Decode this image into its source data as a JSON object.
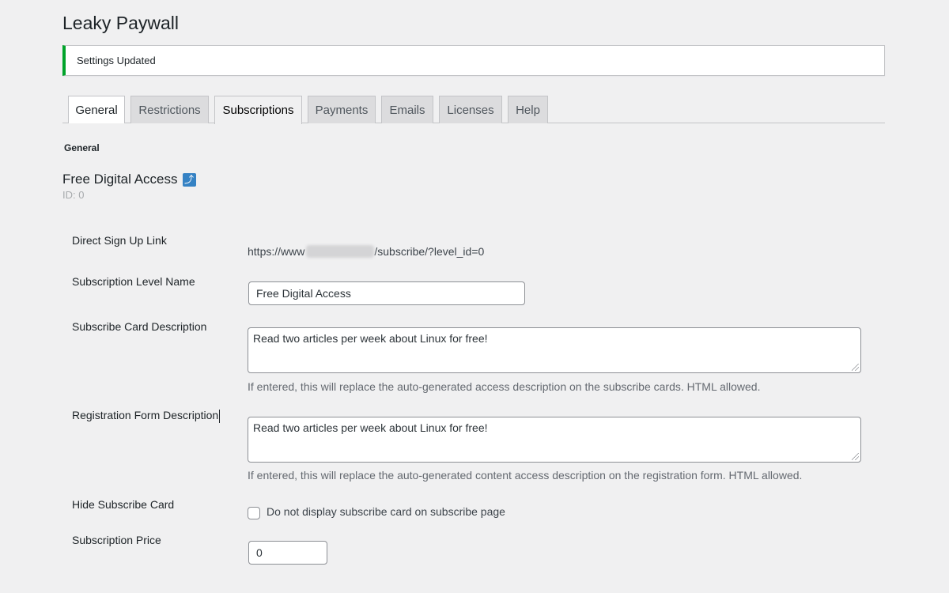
{
  "page": {
    "title": "Leaky Paywall"
  },
  "notice": {
    "text": "Settings Updated",
    "accent_color": "#00a32a"
  },
  "tabs": [
    {
      "label": "General"
    },
    {
      "label": "Restrictions"
    },
    {
      "label": "Subscriptions",
      "active": true
    },
    {
      "label": "Payments"
    },
    {
      "label": "Emails"
    },
    {
      "label": "Licenses"
    },
    {
      "label": "Help"
    }
  ],
  "section": {
    "label": "General"
  },
  "level": {
    "name": "Free Digital Access",
    "icon": "edit-arrow-icon",
    "id_text": "ID: 0"
  },
  "fields": {
    "signup_link": {
      "label": "Direct Sign Up Link",
      "prefix": "https://www",
      "suffix": "/subscribe/?level_id=0"
    },
    "level_name": {
      "label": "Subscription Level Name",
      "value": "Free Digital Access"
    },
    "card_description": {
      "label": "Subscribe Card Description",
      "value": "Read two articles per week about Linux for free!",
      "help": "If entered, this will replace the auto-generated access description on the subscribe cards. HTML allowed."
    },
    "registration_description": {
      "label": "Registration Form Description",
      "value": "Read two articles per week about Linux for free!",
      "help": "If entered, this will replace the auto-generated content access description on the registration form. HTML allowed."
    },
    "hide_card": {
      "label": "Hide Subscribe Card",
      "checkbox_label": "Do not display subscribe card on subscribe page",
      "checked": false
    },
    "price": {
      "label": "Subscription Price",
      "value": "0"
    }
  }
}
